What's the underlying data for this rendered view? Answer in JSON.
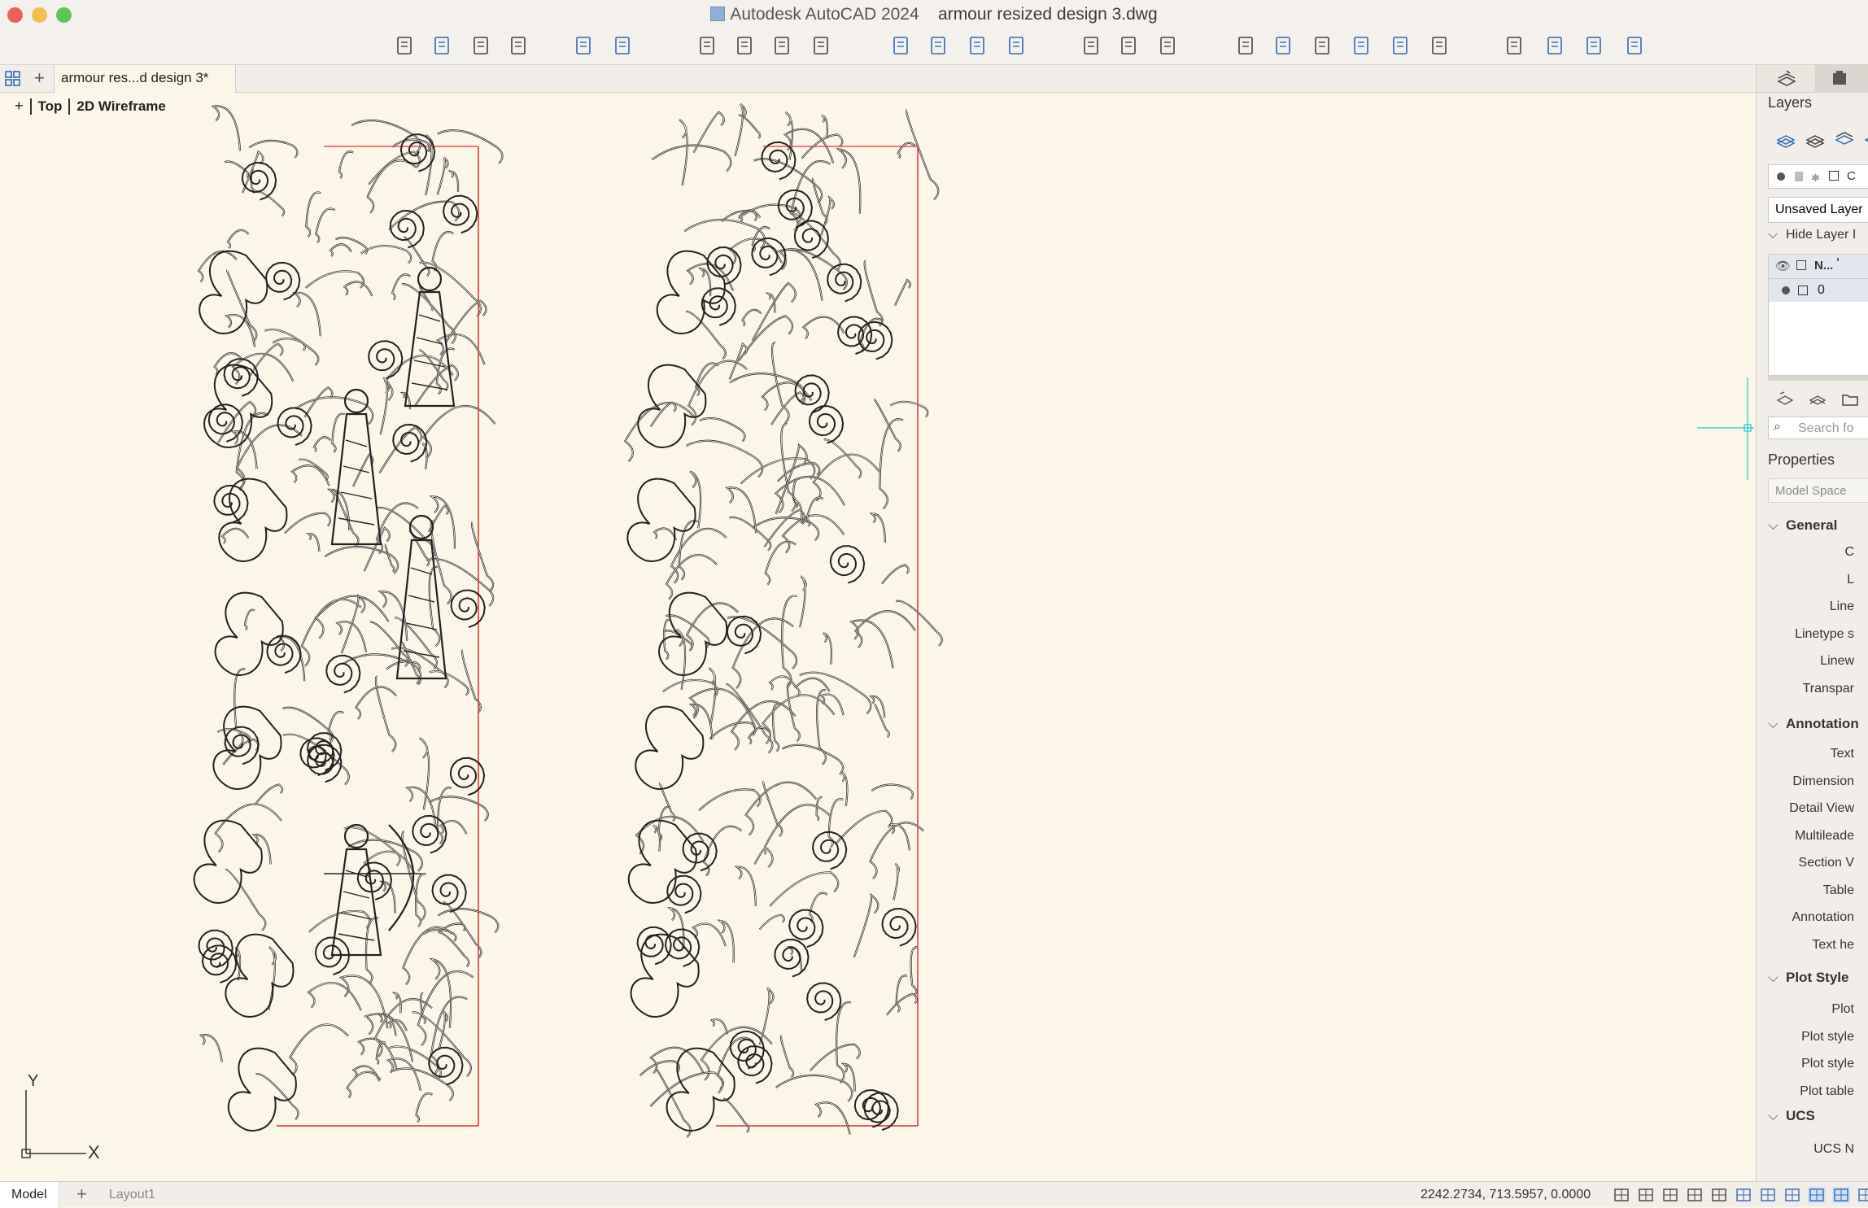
{
  "window": {
    "app_title": "Autodesk AutoCAD 2024",
    "file_title": "armour resized design 3.dwg"
  },
  "toolbar": {
    "icons": [
      "new-icon",
      "open-icon",
      "save-icon",
      "save-as-icon",
      "undo-icon",
      "redo-icon",
      "plot-icon",
      "batch-plot-icon",
      "plot-preview-icon",
      "publish-icon",
      "import-icon",
      "export-icon",
      "share-icon",
      "save-to-web-icon",
      "zoom-icon",
      "pan-icon",
      "orbit-icon",
      "properties-icon",
      "layer-icon",
      "matchprop-icon",
      "block-icon",
      "xref-icon",
      "measure-icon",
      "external-icon",
      "send-icon",
      "cloud-icon",
      "updates-icon"
    ]
  },
  "tabs": {
    "document_tab": "armour res...d design 3*"
  },
  "viewport": {
    "view_name": "Top",
    "visual_style": "2D Wireframe",
    "ucs_y": "Y",
    "ucs_x": "X"
  },
  "right_panel": {
    "layers_title": "Layers",
    "layer_state": "Unsaved Layer",
    "hide_layer": "Hide Layer I",
    "col_name": "N...",
    "layer_0": "0",
    "search_placeholder": "Search fo",
    "properties_title": "Properties",
    "space": "Model Space",
    "sections": {
      "general": "General",
      "annotation": "Annotation",
      "plot_style": "Plot Style",
      "ucs": "UCS"
    },
    "general_rows": [
      "C",
      "L",
      "Line",
      "Linetype s",
      "Linew",
      "Transpar"
    ],
    "annotation_rows": [
      "Text",
      "Dimension",
      "Detail View",
      "Multileade",
      "Section V",
      "Table",
      "Annotation",
      "Text he"
    ],
    "plot_rows": [
      "Plot",
      "Plot style",
      "Plot style",
      "Plot table"
    ],
    "ucs_rows": [
      "UCS N"
    ]
  },
  "statusbar": {
    "model_tab": "Model",
    "layout_tab": "Layout1",
    "coordinates": "2242.2734, 713.5957, 0.0000"
  },
  "colors": {
    "canvas_bg": "#fbf6e8",
    "boundary_red": "#e03030",
    "ucs_cursor": "#20c8d8"
  }
}
